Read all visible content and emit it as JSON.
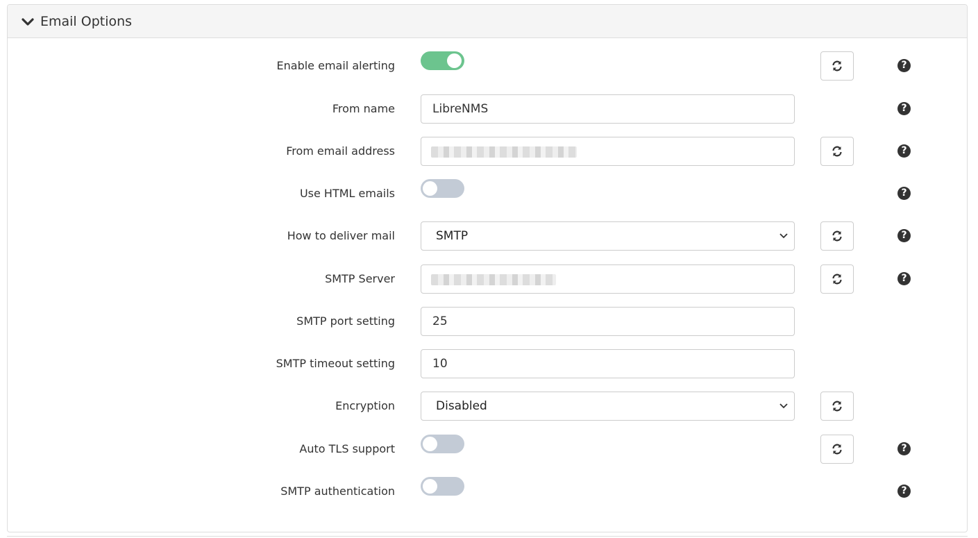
{
  "panel": {
    "title": "Email Options"
  },
  "fields": {
    "enable_alerting": {
      "label": "Enable email alerting",
      "enabled": true
    },
    "from_name": {
      "label": "From name",
      "value": "LibreNMS"
    },
    "from_email": {
      "label": "From email address"
    },
    "html_emails": {
      "label": "Use HTML emails",
      "enabled": false
    },
    "deliver_mail": {
      "label": "How to deliver mail",
      "value": "SMTP"
    },
    "smtp_server": {
      "label": "SMTP Server"
    },
    "smtp_port": {
      "label": "SMTP port setting",
      "value": "25"
    },
    "smtp_timeout": {
      "label": "SMTP timeout setting",
      "value": "10"
    },
    "encryption": {
      "label": "Encryption",
      "value": "Disabled"
    },
    "auto_tls": {
      "label": "Auto TLS support",
      "enabled": false
    },
    "smtp_auth": {
      "label": "SMTP authentication",
      "enabled": false
    }
  },
  "colors": {
    "toggle_on": "#6cc48e",
    "toggle_off": "#c3cbd6",
    "panel_heading_bg": "#f5f5f5"
  },
  "icons": {
    "collapse": "chevron-down-icon",
    "reset": "refresh-icon",
    "help": "question-circle-icon"
  }
}
